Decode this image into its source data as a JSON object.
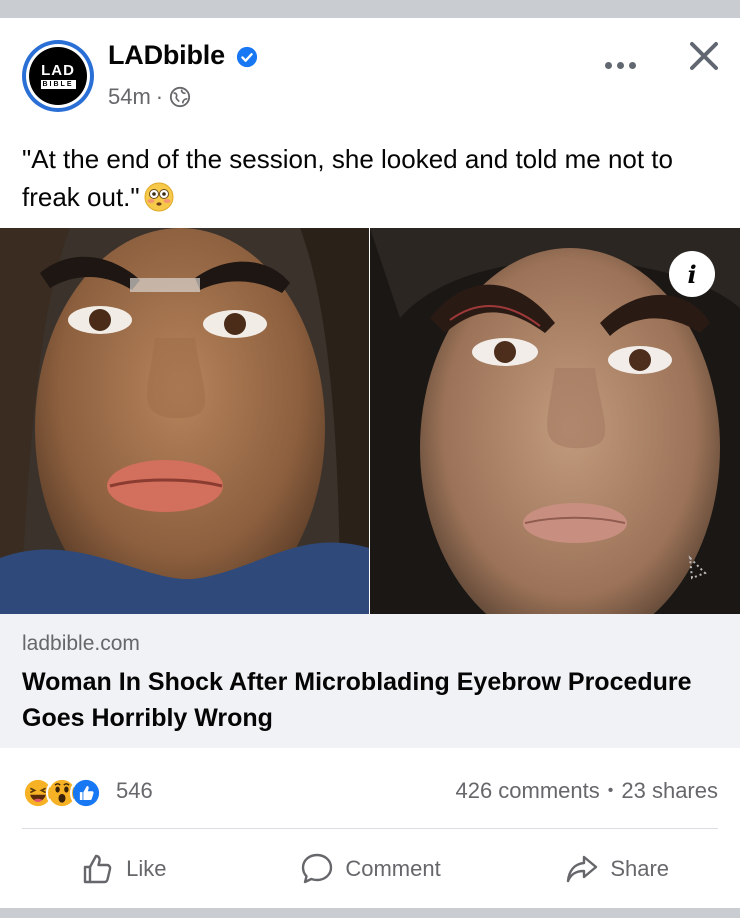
{
  "post": {
    "page_name": "LADbible",
    "logo_top": "LAD",
    "logo_bottom": "BIBLE",
    "time": "54m",
    "dot": "·",
    "text": "\"At the end of the session, she looked and told me not to freak out.\"",
    "emoji": "flushed-face-emoji"
  },
  "image": {
    "info_label": "i"
  },
  "link_preview": {
    "domain": "ladbible.com",
    "headline": "Woman In Shock After Microblading Eyebrow Procedure Goes Horribly Wrong"
  },
  "engagement": {
    "reactions": [
      "haha",
      "wow",
      "like"
    ],
    "reaction_count": "546",
    "comments": "426 comments",
    "separator": "•",
    "shares": "23 shares"
  },
  "actions": {
    "like": "Like",
    "comment": "Comment",
    "share": "Share"
  },
  "colors": {
    "brand_blue": "#1877f2",
    "secondary_text": "#65676b",
    "reaction_yellow": "#f7b125"
  }
}
